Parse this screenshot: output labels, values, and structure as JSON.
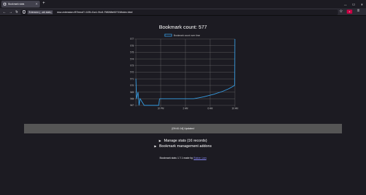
{
  "browser": {
    "tab_title": "Bookmark stats",
    "new_tab": "+",
    "url_identity": "Extension (...ark stats)",
    "url": "moz-extension://67eecd7-1135-41a1-91c5-758268e52719/index.html",
    "ext_badge_color": "#c50042",
    "icons": [
      "back-icon",
      "forward-icon",
      "reload-icon",
      "shield-icon",
      "star-icon",
      "menu-icon",
      "minimize-icon",
      "maximize-icon",
      "close-icon"
    ]
  },
  "page": {
    "title": "Bookmark count: 577",
    "updated": "[09:41:14] Updated",
    "sections": [
      {
        "label": "Manage stats (16 records)"
      },
      {
        "label": "Bookmark management addons"
      }
    ],
    "footer_prefix": "Bookmark stats 1.7.1 made by ",
    "footer_link": "Rainer Lam"
  },
  "chart_data": {
    "type": "line",
    "series": [
      {
        "name": "Bookmark count over time",
        "color": "#36a2eb",
        "x": [
          0,
          0.3,
          1,
          1.5,
          2,
          4,
          8,
          11,
          11.5,
          13,
          14,
          18,
          22,
          28,
          33,
          38,
          42,
          45,
          47.9,
          48
        ],
        "y": [
          571,
          568,
          569,
          567,
          568,
          567,
          567,
          567,
          568,
          568,
          568,
          568,
          568,
          568,
          568.3,
          568.7,
          569.1,
          569.5,
          570,
          577
        ]
      }
    ],
    "x_ticks": [
      {
        "v": 12,
        "label": "10 PM"
      },
      {
        "v": 24,
        "label": "2 AM"
      },
      {
        "v": 36,
        "label": "6 AM"
      },
      {
        "v": 48,
        "label": "10 AM"
      }
    ],
    "ylim": [
      567,
      577
    ],
    "y_ticks": [
      567,
      568,
      569,
      570,
      571,
      572,
      573,
      574,
      575,
      576,
      577
    ],
    "grid": true,
    "legend_position": "top-center"
  }
}
